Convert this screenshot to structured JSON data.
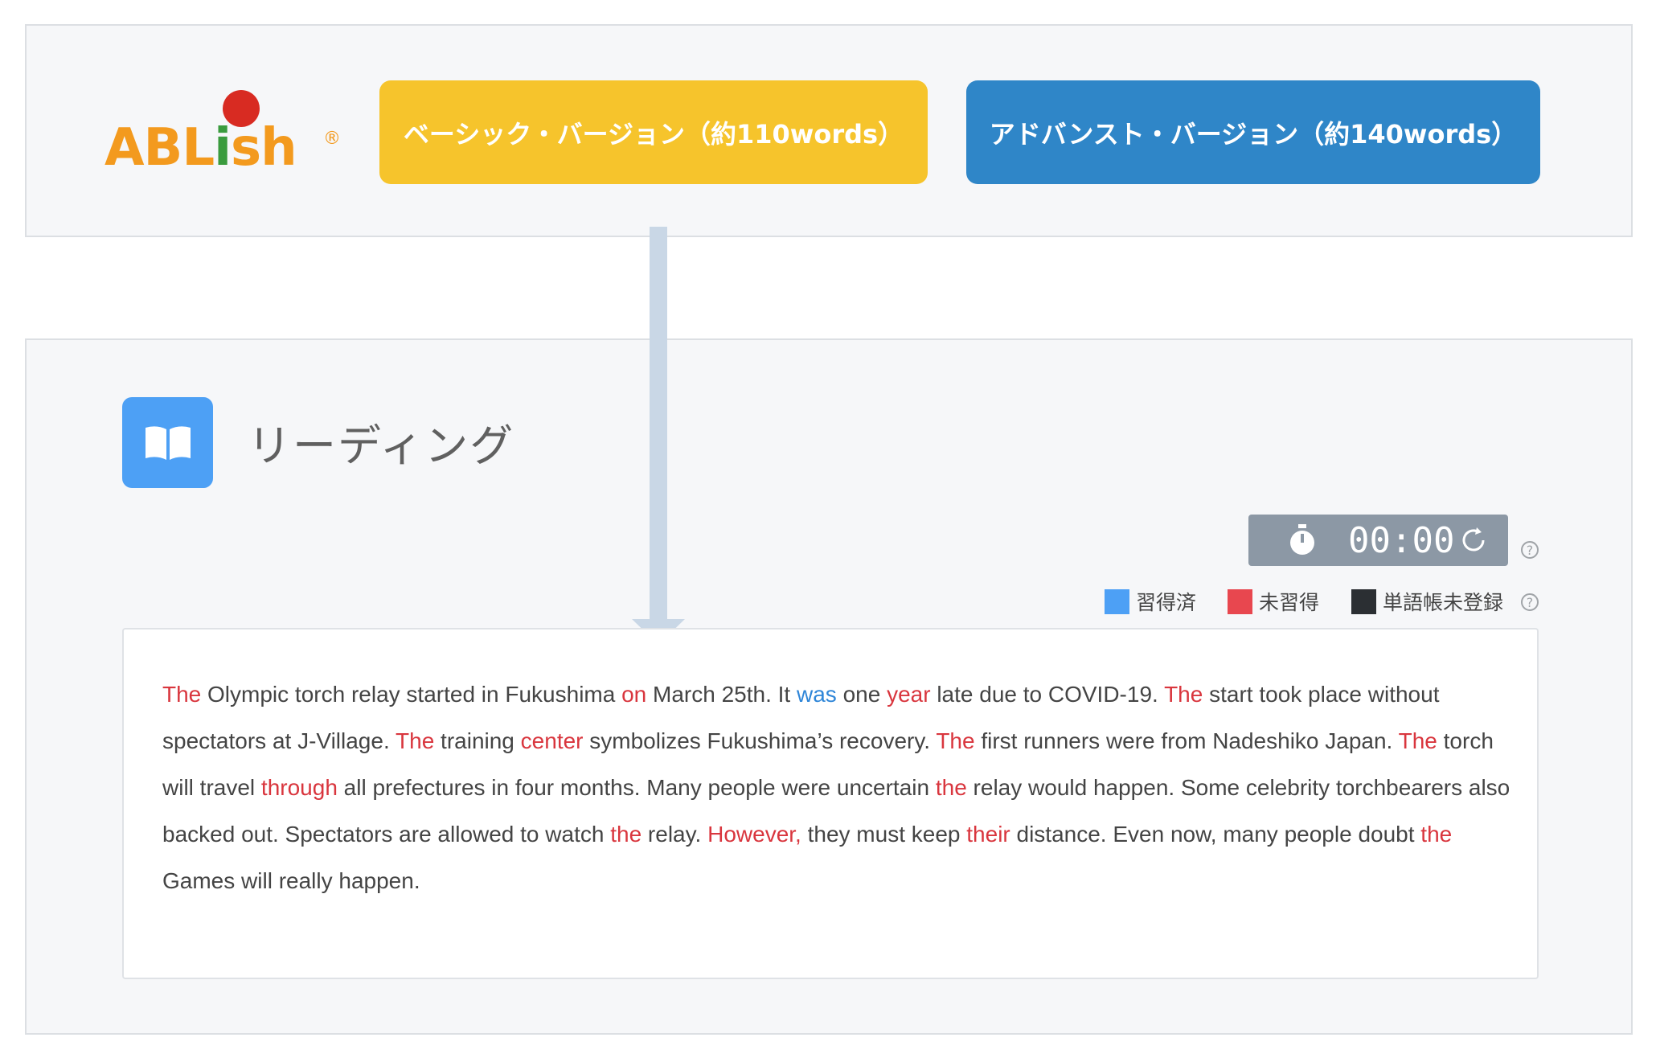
{
  "logo": {
    "part1": "ABL",
    "part2": "i",
    "part3": "sh",
    "registered": "®"
  },
  "versions": {
    "basic_label": "ベーシック・バージョン（約110words）",
    "advanced_label": "アドバンスト・バージョン（約140words）"
  },
  "reading": {
    "title": "リーディング",
    "timer": "00:00",
    "help_glyph": "?",
    "legend": [
      {
        "label": "習得済",
        "color": "#4da0f5"
      },
      {
        "label": "未習得",
        "color": "#e8474f"
      },
      {
        "label": "単語帳未登録",
        "color": "#2b2f33"
      }
    ],
    "passage": [
      {
        "t": "The",
        "c": "red"
      },
      {
        "t": " Olympic torch relay started in Fukushima "
      },
      {
        "t": "on",
        "c": "red"
      },
      {
        "t": " March 25th. It "
      },
      {
        "t": "was",
        "c": "blue"
      },
      {
        "t": " one "
      },
      {
        "t": "year",
        "c": "red"
      },
      {
        "t": " late due to COVID-19. "
      },
      {
        "t": "The",
        "c": "red"
      },
      {
        "t": " start took place without spectators at J-Village. "
      },
      {
        "t": "The",
        "c": "red"
      },
      {
        "t": " training "
      },
      {
        "t": "center",
        "c": "red"
      },
      {
        "t": " symbolizes Fukushima’s recovery. "
      },
      {
        "t": "The",
        "c": "red"
      },
      {
        "t": " first runners were from Nadeshiko Japan. "
      },
      {
        "t": "The",
        "c": "red"
      },
      {
        "t": " torch will travel "
      },
      {
        "t": "through",
        "c": "red"
      },
      {
        "t": " all prefectures in four months. Many people were uncertain "
      },
      {
        "t": "the",
        "c": "red"
      },
      {
        "t": " relay would happen. Some celebrity torchbearers also backed out. Spectators are allowed to watch "
      },
      {
        "t": "the",
        "c": "red"
      },
      {
        "t": " relay. "
      },
      {
        "t": "However,",
        "c": "red"
      },
      {
        "t": " they must keep "
      },
      {
        "t": "their",
        "c": "red"
      },
      {
        "t": " distance. Even now, many people doubt "
      },
      {
        "t": "the",
        "c": "red"
      },
      {
        "t": " Games will really happen."
      }
    ]
  },
  "colors": {
    "basic": "#f6c42c",
    "advanced": "#2f86c8",
    "arrow": "#c9d7e6",
    "icon": "#4da0f5"
  }
}
